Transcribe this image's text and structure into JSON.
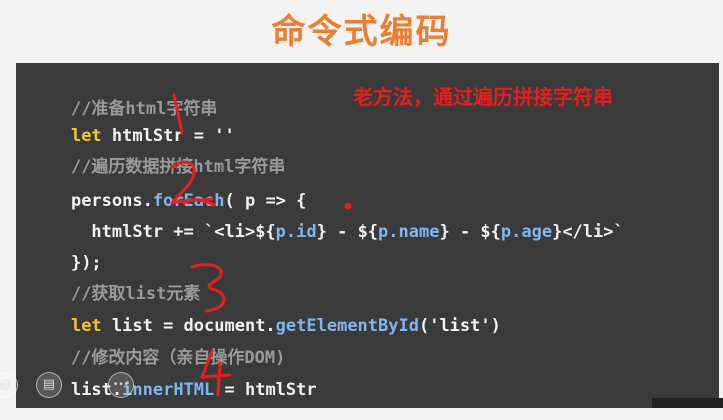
{
  "slide": {
    "title": "命令式编码"
  },
  "annotation": {
    "text": "老方法，通过遍历拼接字符串",
    "color": "#e81d1d"
  },
  "code": {
    "line1": {
      "comment": "//准备html字符串"
    },
    "line2": {
      "kw": "let",
      "rest": " htmlStr = ''"
    },
    "line3": {
      "comment": "//遍历数据拼接html字符串"
    },
    "line4": {
      "obj": "persons.",
      "method": "forEach",
      "rest": "( p => {"
    },
    "line5": {
      "indent": "  htmlStr += ",
      "p1": "`<li>${",
      "v1": "p.id",
      "p2": "} - ${",
      "v2": "p.name",
      "p3": "} - ${",
      "v3": "p.age",
      "p4": "}</li>`"
    },
    "line6": {
      "text": "});"
    },
    "line7": {
      "comment": "//获取list元素"
    },
    "line8": {
      "kw": "let",
      "mid": " list = document.",
      "method": "getElementById",
      "rest": "('list')"
    },
    "line9": {
      "comment": "//修改内容（亲自操作DOM)"
    },
    "line10": {
      "obj": "list.",
      "prop": "innerHTML",
      "rest": " = htmlStr"
    }
  },
  "player": {
    "buttons": [
      {
        "icon": "back-icon",
        "glyph": "◎"
      },
      {
        "icon": "menu-icon",
        "glyph": "▤"
      },
      {
        "icon": "more-icon",
        "glyph": "•••"
      }
    ]
  },
  "colors": {
    "title": "#ee7d2f",
    "panel_bg": "#3a3a3a",
    "comment": "#9a9a9a",
    "keyword": "#f0c830",
    "function": "#7fb6ef",
    "handwriting": "#e81d1d"
  }
}
